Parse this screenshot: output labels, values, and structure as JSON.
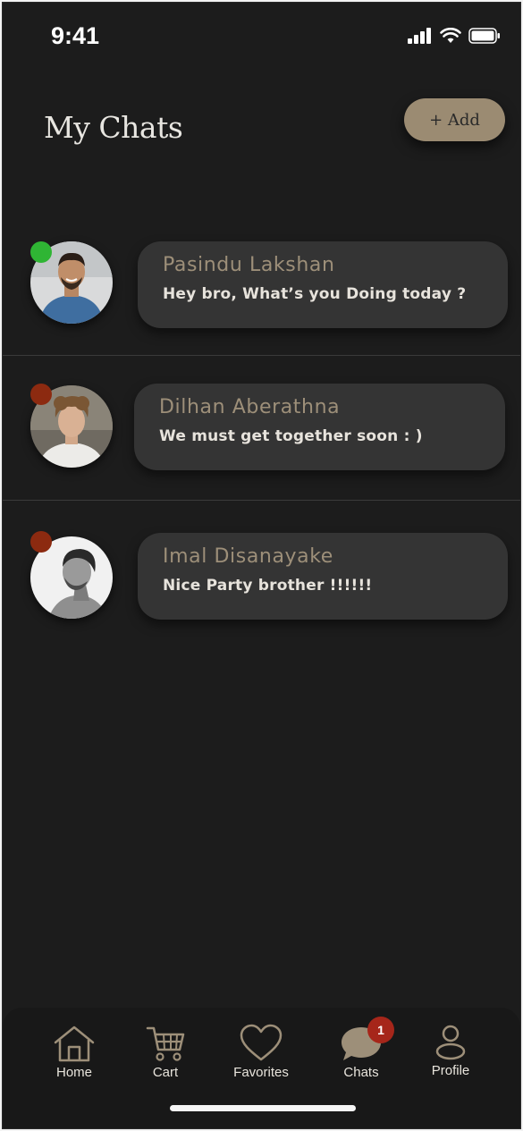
{
  "status_bar": {
    "time": "9:41"
  },
  "header": {
    "title": "My Chats",
    "add_label": "+ Add"
  },
  "chats": [
    {
      "name": "Pasindu Lakshan",
      "message": "Hey bro, What’s you Doing today ?",
      "status_color": "#2fb534"
    },
    {
      "name": "Dilhan Aberathna",
      "message": "We must get together soon : )",
      "status_color": "#8c2a10"
    },
    {
      "name": "Imal Disanayake",
      "message": "Nice Party brother !!!!!!",
      "status_color": "#8c2a10"
    }
  ],
  "nav": {
    "items": [
      {
        "label": "Home",
        "icon": "home-icon"
      },
      {
        "label": "Cart",
        "icon": "cart-icon"
      },
      {
        "label": "Favorites",
        "icon": "heart-icon"
      },
      {
        "label": "Chats",
        "icon": "chat-bubble-icon",
        "badge": "1"
      },
      {
        "label": "Profile",
        "icon": "user-icon"
      }
    ]
  },
  "colors": {
    "background": "#1c1c1c",
    "accent": "#9b8b72",
    "bubble": "#343434",
    "badge": "#a6261a"
  }
}
